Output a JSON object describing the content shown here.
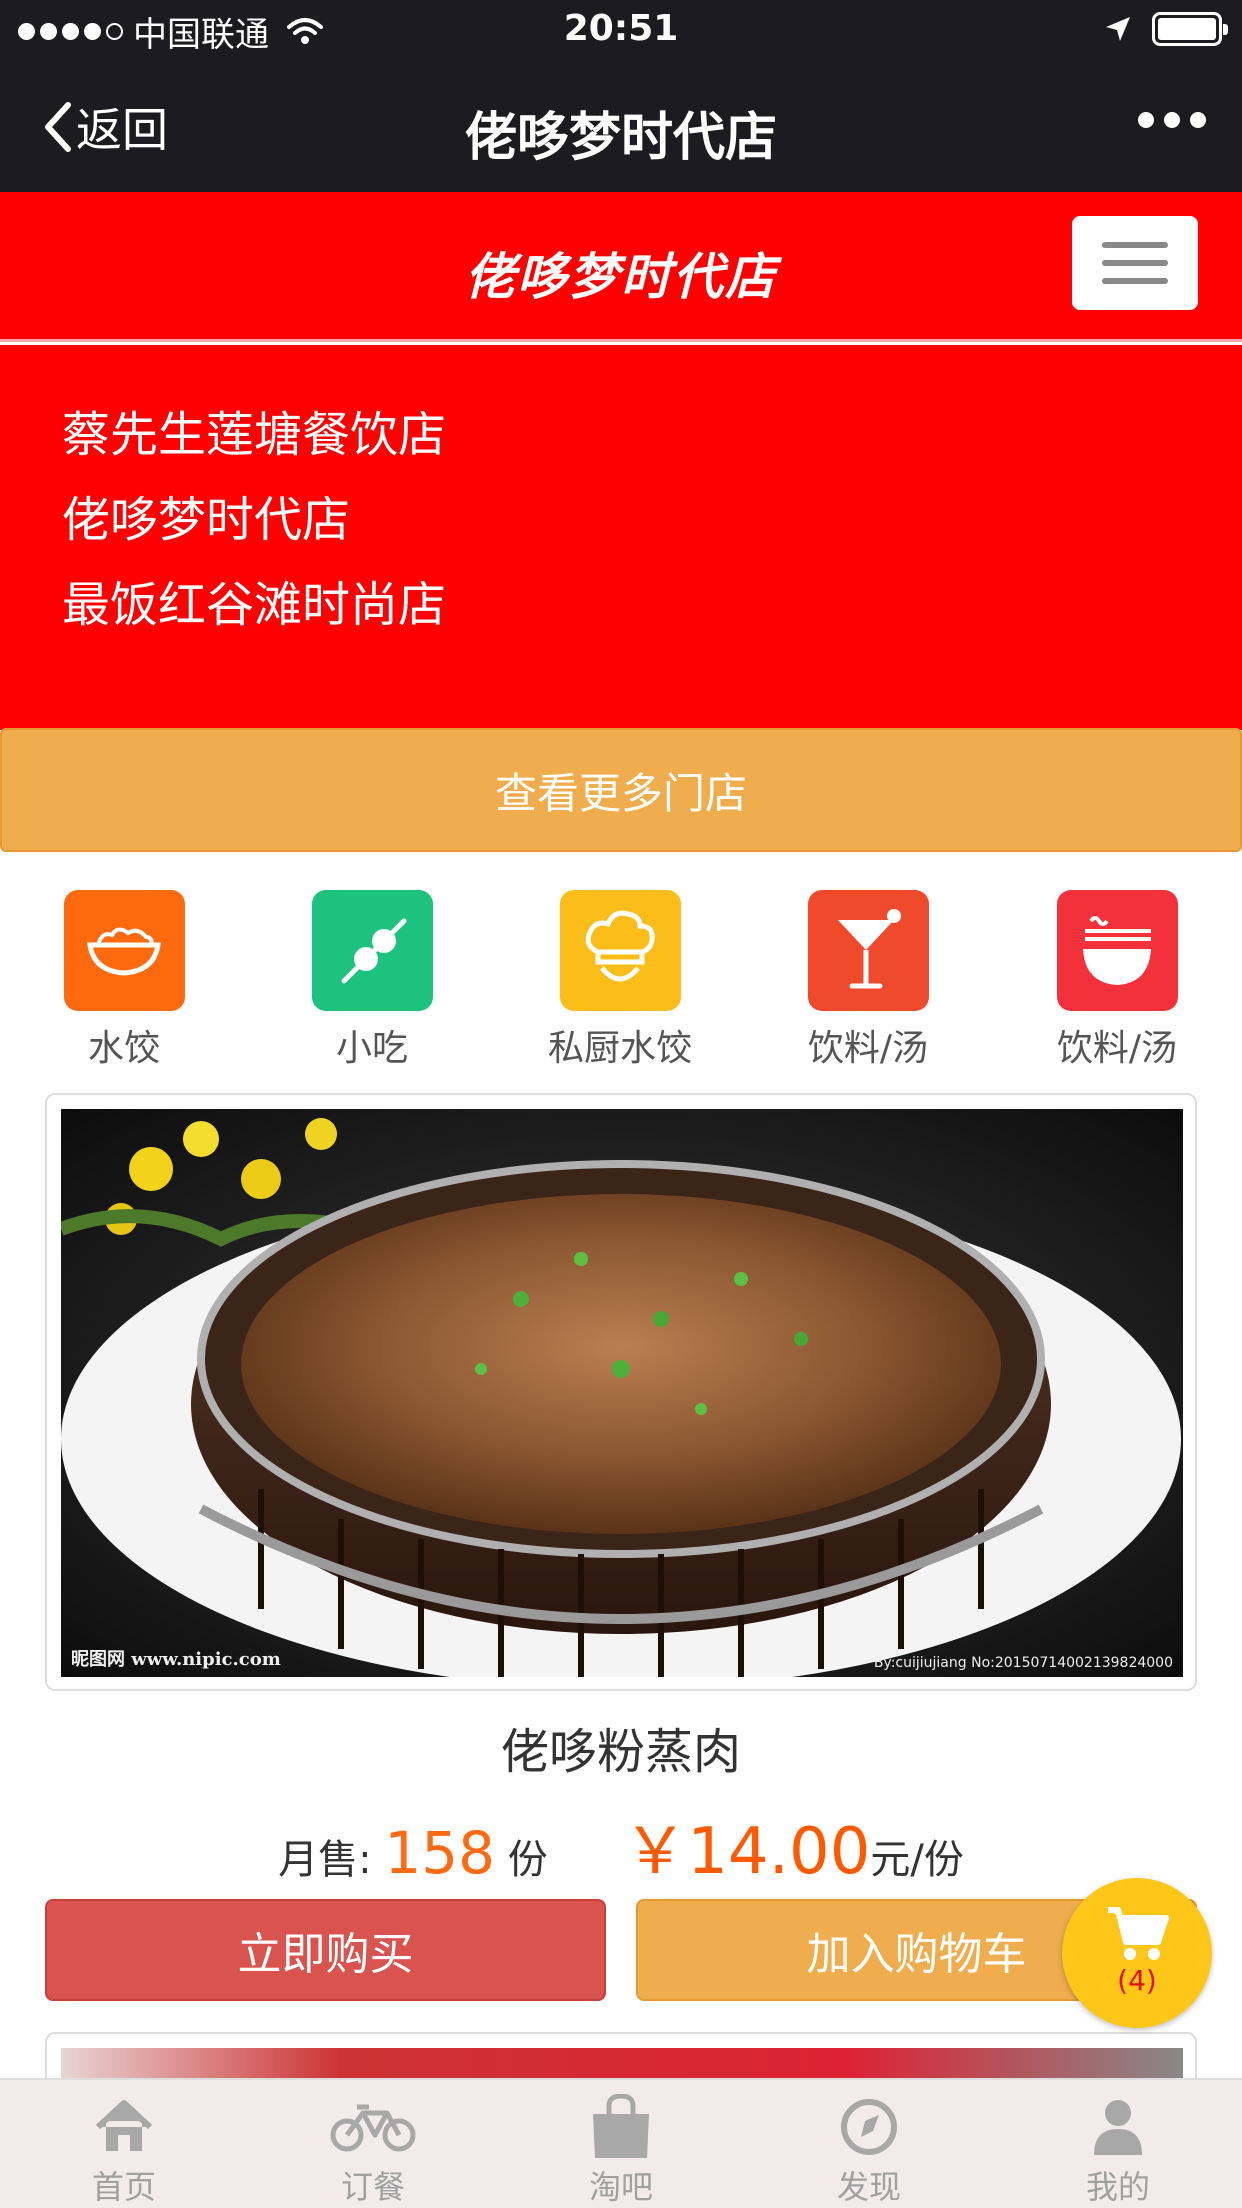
{
  "status_bar": {
    "carrier": "中国联通",
    "time": "20:51"
  },
  "nav": {
    "back_label": "返回",
    "title": "佬哆梦时代店"
  },
  "header": {
    "brand": "佬哆梦时代店"
  },
  "dropdown": {
    "stores": [
      "蔡先生莲塘餐饮店",
      "佬哆梦时代店",
      "最饭红谷滩时尚店"
    ],
    "more_label": "查看更多门店"
  },
  "categories": [
    {
      "label": "水饺",
      "icon": "bowl-icon",
      "color": "#ff6a0e"
    },
    {
      "label": "小吃",
      "icon": "skewer-icon",
      "color": "#1cc27e"
    },
    {
      "label": "私厨水饺",
      "icon": "chef-hat-icon",
      "color": "#fbbd19"
    },
    {
      "label": "饮料/汤",
      "icon": "cocktail-icon",
      "color": "#f04a2c"
    },
    {
      "label": "饮料/汤",
      "icon": "noodle-bowl-icon",
      "color": "#f3313b"
    }
  ],
  "product": {
    "name": "佬哆粉蒸肉",
    "sales_label": "月售:",
    "sales_count": "158",
    "sales_unit": "份",
    "price_symbol": "￥",
    "price": "14.00",
    "price_unit": "元/份",
    "buy_label": "立即购买",
    "cart_label": "加入购物车",
    "watermark_left": "昵图网 www.nipic.com",
    "watermark_right": "By:cuijiujiang No:20150714002139824000"
  },
  "cart": {
    "count": "(4)"
  },
  "tabbar": {
    "items": [
      {
        "label": "首页",
        "icon": "home-icon"
      },
      {
        "label": "订餐",
        "icon": "bicycle-icon"
      },
      {
        "label": "淘吧",
        "icon": "shopping-bag-icon"
      },
      {
        "label": "发现",
        "icon": "compass-icon"
      },
      {
        "label": "我的",
        "icon": "user-icon"
      }
    ]
  },
  "colors": {
    "header_red": "#ff0000",
    "more_orange": "#f0ad4e",
    "buy_red": "#d9534f",
    "price_orange": "#ff6a13",
    "cart_yellow": "#ffc61a"
  }
}
